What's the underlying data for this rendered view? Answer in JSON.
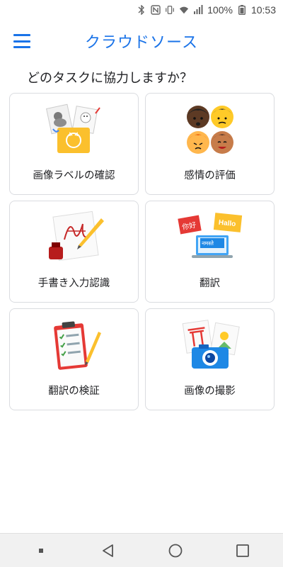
{
  "status_bar": {
    "battery": "100%",
    "time": "10:53",
    "icons": [
      "bluetooth-icon",
      "nfc-icon",
      "vibrate-icon",
      "wifi-icon",
      "signal-icon",
      "battery-icon"
    ]
  },
  "app_bar": {
    "title": "クラウドソース",
    "menu_icon": "hamburger-menu-icon"
  },
  "question": "どのタスクに協力しますか？",
  "tasks": [
    {
      "label": "画像ラベルの確認",
      "icon": "image-label-illustration"
    },
    {
      "label": "感情の評価",
      "icon": "faces-emotion-illustration"
    },
    {
      "label": "手書き入力認識",
      "icon": "handwriting-illustration"
    },
    {
      "label": "翻訳",
      "icon": "translation-illustration"
    },
    {
      "label": "翻訳の検証",
      "icon": "clipboard-check-illustration"
    },
    {
      "label": "画像の撮影",
      "icon": "camera-photos-illustration"
    }
  ],
  "translation_words": [
    "你好",
    "Hallo",
    "नमस्ते"
  ],
  "nav_bar": {
    "items": [
      "square-dot-icon",
      "back-icon",
      "home-icon",
      "recents-icon"
    ]
  },
  "colors": {
    "accent": "#1a73e8",
    "card_border": "#dadce0",
    "nav_bg": "#f1f1f1"
  }
}
